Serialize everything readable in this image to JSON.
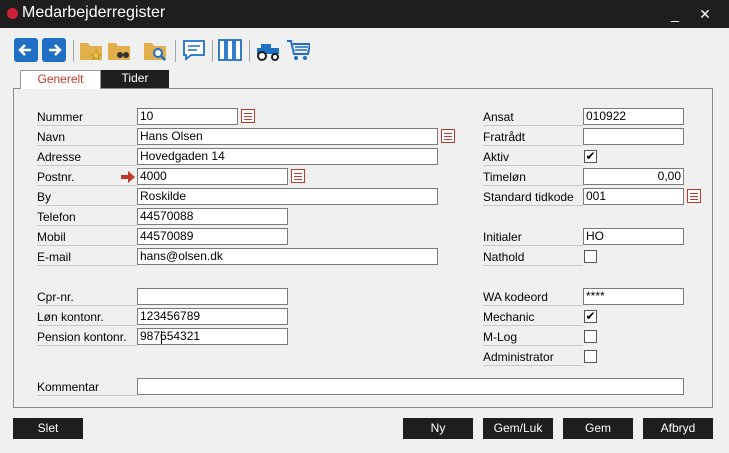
{
  "window": {
    "title": "Medarbejderregister",
    "minimize": "_",
    "close": "✕"
  },
  "toolbar": {
    "icons": [
      "back-arrow-icon",
      "forward-arrow-icon",
      "folder-star-icon",
      "folder-binoculars-icon",
      "folder-search-icon",
      "speech-bubble-icon",
      "binders-icon",
      "tractor-icon",
      "shopping-cart-icon"
    ]
  },
  "tabs": [
    {
      "label": "Generelt"
    },
    {
      "label": "Tider"
    }
  ],
  "form": {
    "nummer": {
      "label": "Nummer",
      "value": "10"
    },
    "navn": {
      "label": "Navn",
      "value": "Hans Olsen"
    },
    "adresse": {
      "label": "Adresse",
      "value": "Hovedgaden 14"
    },
    "postnr": {
      "label": "Postnr.",
      "value": "4000"
    },
    "by": {
      "label": "By",
      "value": "Roskilde"
    },
    "telefon": {
      "label": "Telefon",
      "value": "44570088"
    },
    "mobil": {
      "label": "Mobil",
      "value": "44570089"
    },
    "email": {
      "label": "E-mail",
      "value": "hans@olsen.dk"
    },
    "cpr": {
      "label": "Cpr-nr.",
      "value": ""
    },
    "lon_konto": {
      "label": "Løn kontonr.",
      "value": "123456789"
    },
    "pension_konto": {
      "label": "Pension kontonr.",
      "value": "987654321"
    },
    "kommentar": {
      "label": "Kommentar",
      "value": ""
    },
    "ansat": {
      "label": "Ansat",
      "value": "010922"
    },
    "fratraadt": {
      "label": "Fratrådt",
      "value": ""
    },
    "aktiv": {
      "label": "Aktiv",
      "checked": true
    },
    "timelon": {
      "label": "Timeløn",
      "value": "0,00"
    },
    "standard_tidkode": {
      "label": "Standard tidkode",
      "value": "001"
    },
    "initialer": {
      "label": "Initialer",
      "value": "HO"
    },
    "nathold": {
      "label": "Nathold",
      "checked": false
    },
    "wa_kodeord": {
      "label": "WA kodeord",
      "value": "****"
    },
    "mechanic": {
      "label": "Mechanic",
      "checked": true
    },
    "mlog": {
      "label": "M-Log",
      "checked": false
    },
    "administrator": {
      "label": "Administrator",
      "checked": false
    }
  },
  "buttons": {
    "slet": "Slet",
    "ny": "Ny",
    "gemluk": "Gem/Luk",
    "gem": "Gem",
    "afbryd": "Afbryd"
  },
  "colors": {
    "accent": "#c0392b",
    "dark": "#1e1e1e",
    "toolbar_blue": "#1f6fc4"
  }
}
